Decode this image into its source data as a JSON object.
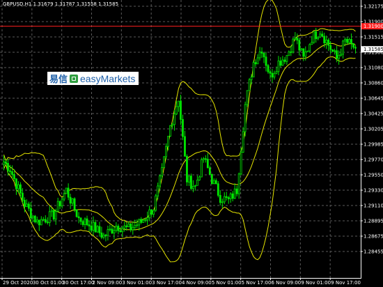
{
  "chart_window": {
    "symbol_label": "GBPUSD,H1  1.31679 1.31787 1.31558 1.31585",
    "logo": {
      "chinese": "易信",
      "english": "easyMarkets"
    }
  },
  "chart_data": {
    "type": "candlestick",
    "symbol": "GBPUSD",
    "timeframe": "H1",
    "ohlc": {
      "open": 1.31679,
      "high": 1.31787,
      "low": 1.31558,
      "close": 1.31585
    },
    "ylim": [
      1.2836,
      1.3228
    ],
    "y_ticks": [
      "1.32175",
      "1.31900",
      "1.31515",
      "1.31300",
      "1.31080",
      "1.30860",
      "1.30645",
      "1.30425",
      "1.30205",
      "1.29985",
      "1.29770",
      "1.29550",
      "1.29330",
      "1.29110",
      "1.28895",
      "1.28675",
      "1.28455"
    ],
    "x_ticks": [
      "29 Oct 2020",
      "30 Oct 01:00",
      "30 Oct 17:00",
      "2 Nov 09:00",
      "3 Nov 01:00",
      "3 Nov 17:00",
      "4 Nov 09:00",
      "5 Nov 01:00",
      "5 Nov 17:00",
      "6 Nov 09:00",
      "9 Nov 01:00",
      "9 Nov 17:00"
    ],
    "horizontal_line": {
      "value": 1.3191,
      "label": "1.31900",
      "color": "#ff2020"
    },
    "current_price": {
      "value": 1.31585,
      "label": "1.31585"
    },
    "candle_color": "#00e600",
    "band_color": "#e6e600",
    "grid": true,
    "anchors": [
      {
        "i": 0,
        "p": 1.3
      },
      {
        "i": 3,
        "p": 1.299
      },
      {
        "i": 10,
        "p": 1.294
      },
      {
        "i": 16,
        "p": 1.2915
      },
      {
        "i": 24,
        "p": 1.2925
      },
      {
        "i": 30,
        "p": 1.296
      },
      {
        "i": 36,
        "p": 1.292
      },
      {
        "i": 42,
        "p": 1.291
      },
      {
        "i": 48,
        "p": 1.2895
      },
      {
        "i": 54,
        "p": 1.291
      },
      {
        "i": 60,
        "p": 1.2905
      },
      {
        "i": 66,
        "p": 1.2915
      },
      {
        "i": 72,
        "p": 1.2935
      },
      {
        "i": 76,
        "p": 1.2985
      },
      {
        "i": 80,
        "p": 1.305
      },
      {
        "i": 84,
        "p": 1.309
      },
      {
        "i": 88,
        "p": 1.2975
      },
      {
        "i": 92,
        "p": 1.2965
      },
      {
        "i": 96,
        "p": 1.3005
      },
      {
        "i": 100,
        "p": 1.2975
      },
      {
        "i": 104,
        "p": 1.295
      },
      {
        "i": 108,
        "p": 1.2945
      },
      {
        "i": 112,
        "p": 1.296
      },
      {
        "i": 116,
        "p": 1.308
      },
      {
        "i": 120,
        "p": 1.314
      },
      {
        "i": 124,
        "p": 1.316
      },
      {
        "i": 128,
        "p": 1.312
      },
      {
        "i": 132,
        "p": 1.314
      },
      {
        "i": 136,
        "p": 1.315
      },
      {
        "i": 140,
        "p": 1.3175
      },
      {
        "i": 144,
        "p": 1.3145
      },
      {
        "i": 148,
        "p": 1.3175
      },
      {
        "i": 152,
        "p": 1.3185
      },
      {
        "i": 156,
        "p": 1.3165
      },
      {
        "i": 160,
        "p": 1.3145
      },
      {
        "i": 164,
        "p": 1.317
      },
      {
        "i": 169,
        "p": 1.316
      }
    ]
  }
}
